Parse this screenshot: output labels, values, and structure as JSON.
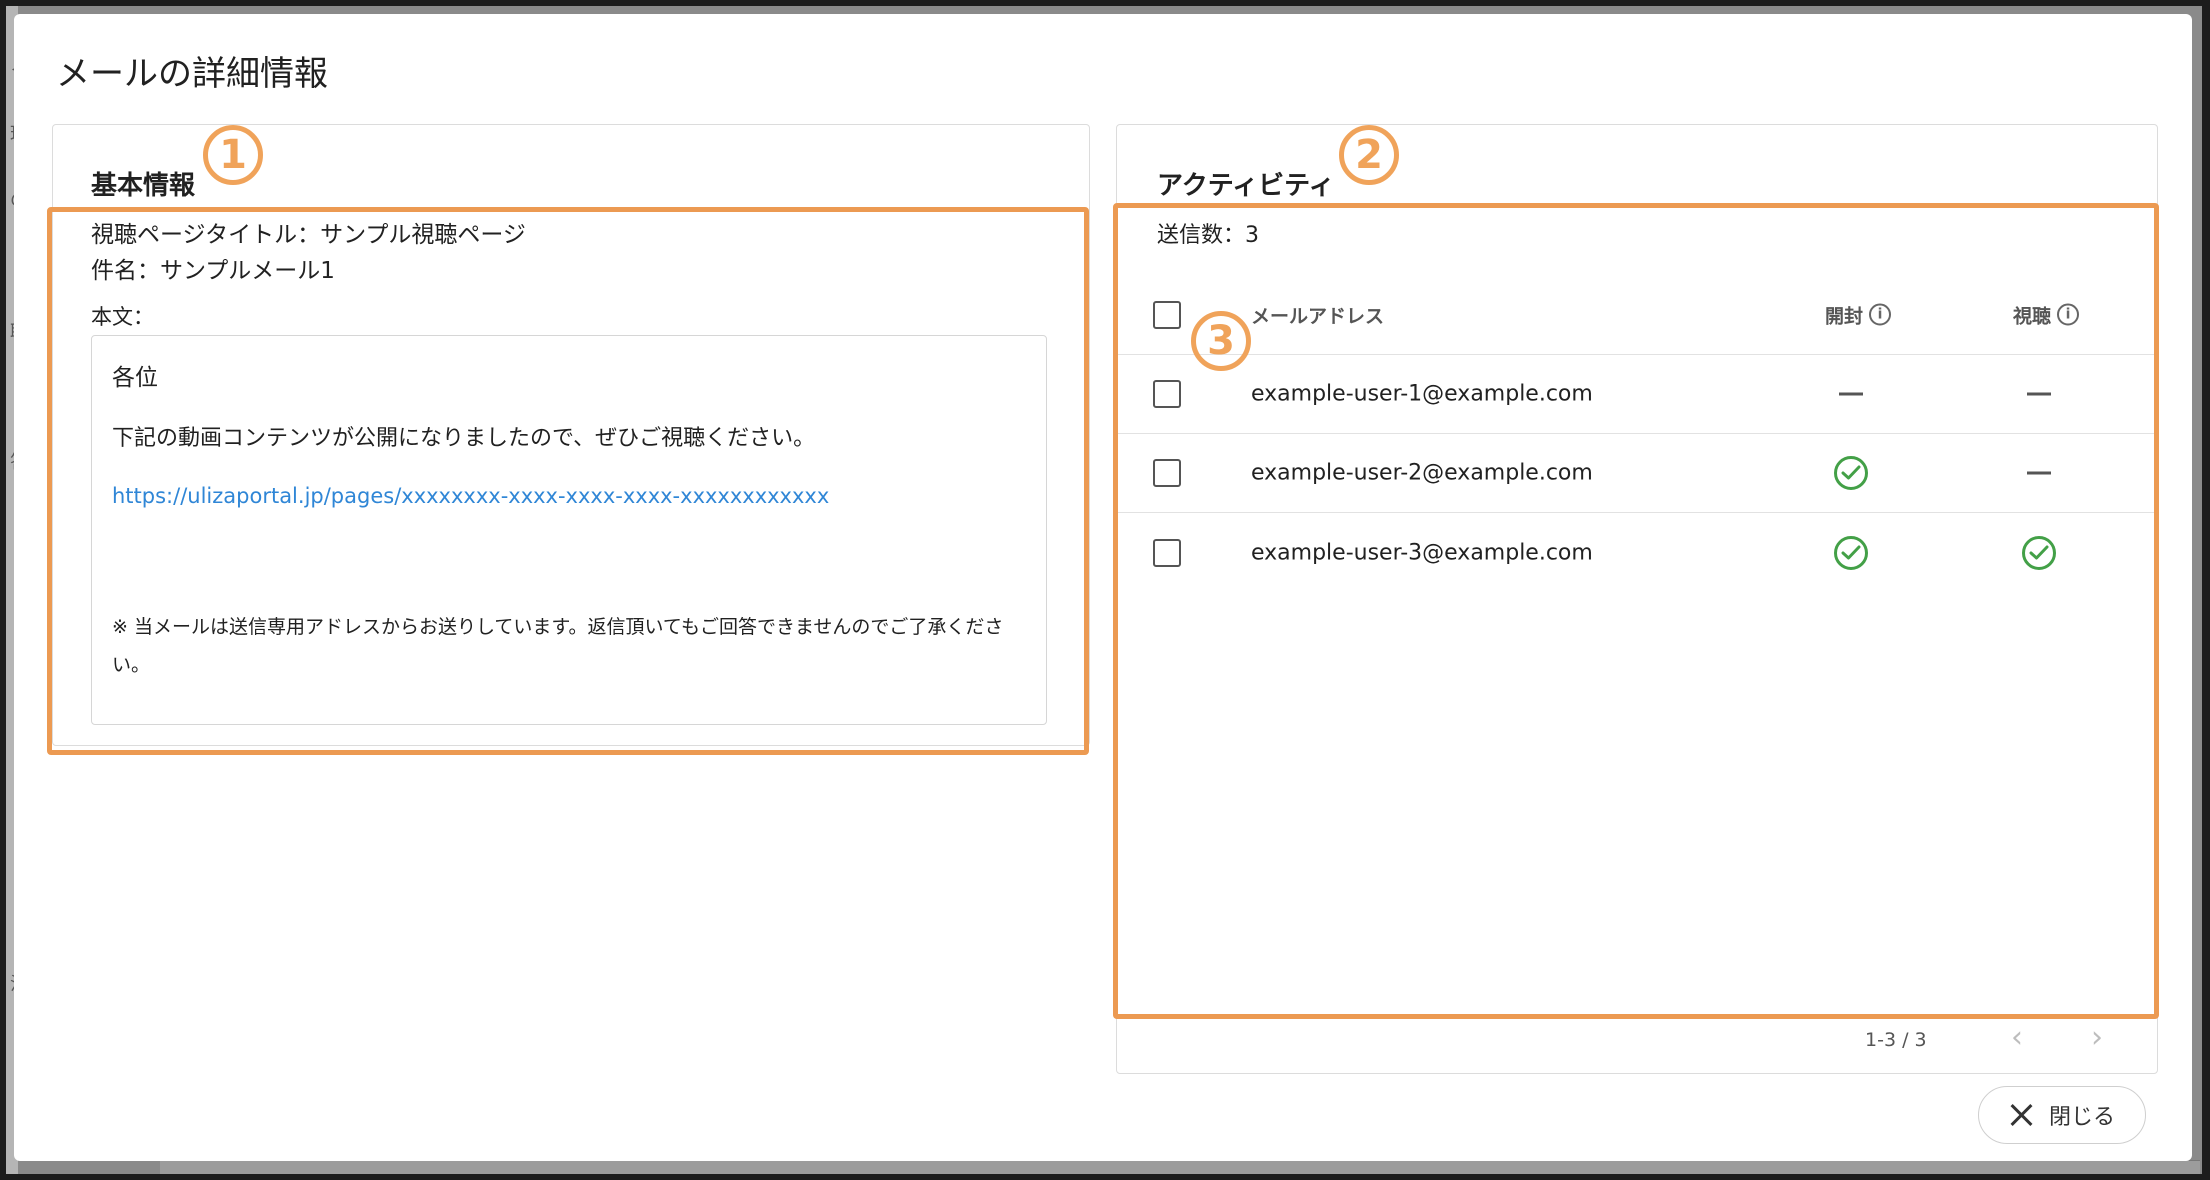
{
  "modal": {
    "title": "メールの詳細情報",
    "close_label": "閉じる"
  },
  "backdrop": {
    "side_chars": [
      "メ",
      "理",
      "の",
      "聴",
      "答",
      "況"
    ]
  },
  "basic_info": {
    "title": "基本情報",
    "badge": "1",
    "page_title_line": "視聴ページタイトル：サンプル視聴ページ",
    "subject_line": "件名：サンプルメール1",
    "body_label": "本文：",
    "body": {
      "greeting": "各位",
      "paragraph": "下記の動画コンテンツが公開になりましたので、ぜひご視聴ください。",
      "link": "https://ulizaportal.jp/pages/xxxxxxxx-xxxx-xxxx-xxxx-xxxxxxxxxxxx",
      "note": "※ 当メールは送信専用アドレスからお送りしています。返信頂いてもご回答できませんのでご了承ください。"
    }
  },
  "activity": {
    "title": "アクティビティ",
    "badge": "2",
    "table_badge": "3",
    "send_count_line": "送信数：3",
    "columns": {
      "email": "メールアドレス",
      "opened": "開封",
      "viewed": "視聴"
    },
    "rows": [
      {
        "email": "example-user-1@example.com",
        "opened": false,
        "viewed": false
      },
      {
        "email": "example-user-2@example.com",
        "opened": true,
        "viewed": false
      },
      {
        "email": "example-user-3@example.com",
        "opened": true,
        "viewed": true
      }
    ],
    "pagination": {
      "info": "1-3 / 3",
      "prev_icon": "chevron-left-icon",
      "next_icon": "chevron-right-icon"
    }
  },
  "colors": {
    "highlight": "#ec9a52",
    "link": "#2f86d6",
    "check": "#43a047"
  }
}
